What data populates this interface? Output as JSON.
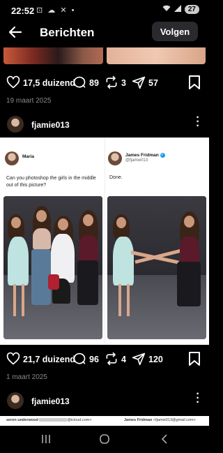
{
  "status": {
    "time": "22:52",
    "battery": "27"
  },
  "header": {
    "title": "Berichten",
    "follow_label": "Volgen"
  },
  "post1": {
    "likes": "17,5 duizend",
    "comments": "89",
    "reposts": "3",
    "shares": "57",
    "date": "19 maart 2025"
  },
  "user": {
    "name": "fjamie013"
  },
  "tweet_left": {
    "name": "Maria",
    "text": "Can you photoshop the girls in the middle out of this picture?"
  },
  "tweet_right": {
    "name": "James Fridman",
    "handle": "@fjamie013",
    "text": "Done."
  },
  "post2": {
    "likes": "21,7 duizend",
    "comments": "96",
    "reposts": "4",
    "shares": "120",
    "date": "1 maart 2025"
  },
  "next_post": {
    "left_name": "seren underwood",
    "left_email": "@icloud.com>",
    "right_name": "James Fridman",
    "right_email": "<fjamie013@gmail.com>"
  },
  "icons": {
    "back": "arrow-left-icon",
    "like": "heart-icon",
    "comment": "speech-bubble-icon",
    "repost": "repost-icon",
    "share": "paper-plane-icon",
    "save": "bookmark-icon",
    "more": "more-vertical-icon",
    "nav_recent": "recent-apps-icon",
    "nav_home": "home-icon",
    "nav_back": "back-nav-icon"
  }
}
